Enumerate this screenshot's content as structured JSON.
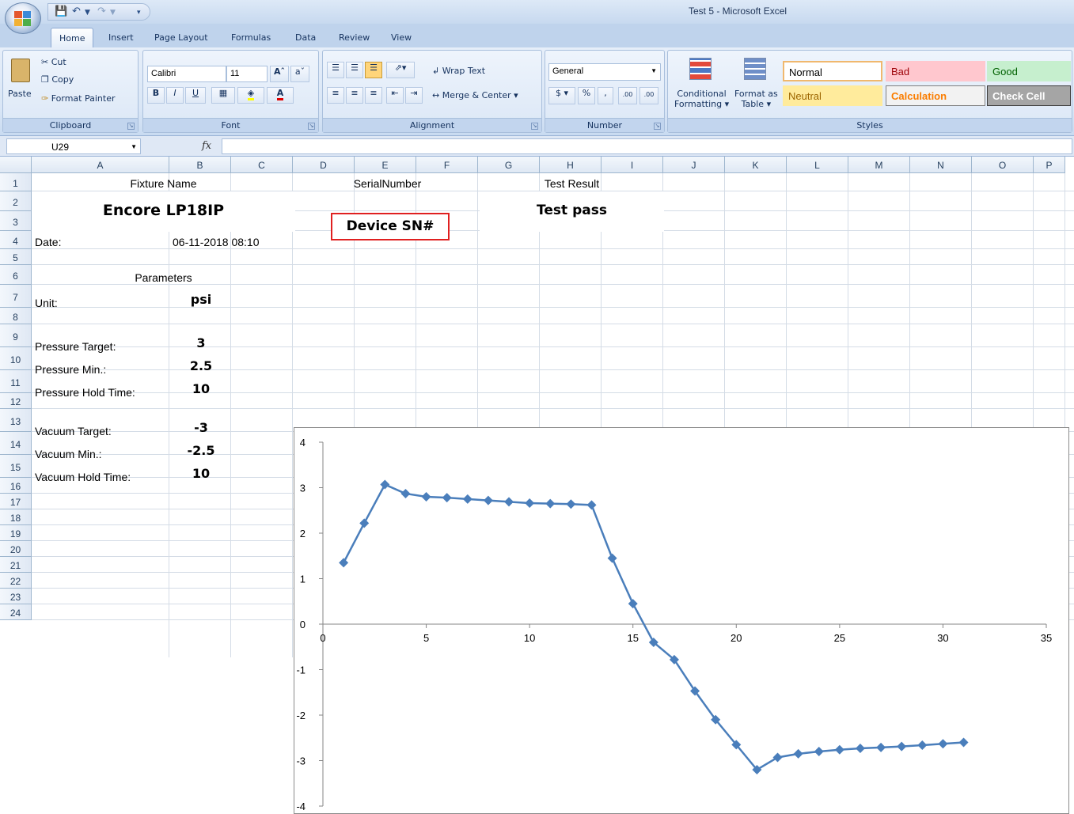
{
  "window": {
    "title": "Test 5 - Microsoft Excel"
  },
  "ribbon": {
    "tabs": [
      "Home",
      "Insert",
      "Page Layout",
      "Formulas",
      "Data",
      "Review",
      "View"
    ],
    "active_tab": "Home",
    "clipboard": {
      "paste": "Paste",
      "cut": "Cut",
      "copy": "Copy",
      "format_painter": "Format Painter",
      "label": "Clipboard"
    },
    "font": {
      "name": "Calibri",
      "size": "11",
      "label": "Font",
      "bold": "B",
      "italic": "I",
      "underline": "U"
    },
    "alignment": {
      "wrap_text": "Wrap Text",
      "merge_center": "Merge & Center",
      "label": "Alignment"
    },
    "number": {
      "format": "General",
      "label": "Number",
      "currency": "$",
      "percent": "%",
      "comma": ",",
      "inc_decimal": ".00",
      "dec_decimal": ".00"
    },
    "styles": {
      "conditional_formatting": [
        "Conditional",
        "Formatting"
      ],
      "format_as_table": [
        "Format as",
        "Table"
      ],
      "label": "Styles",
      "cells": [
        {
          "name": "Normal",
          "bg": "#ffffff",
          "fg": "#000000",
          "border": "#f0b86e"
        },
        {
          "name": "Bad",
          "bg": "#ffc7ce",
          "fg": "#9c0006",
          "border": "#ffc7ce"
        },
        {
          "name": "Good",
          "bg": "#c6efce",
          "fg": "#006100",
          "border": "#c6efce"
        },
        {
          "name": "Neutral",
          "bg": "#ffeb9c",
          "fg": "#9c6500",
          "border": "#ffeb9c"
        },
        {
          "name": "Calculation",
          "bg": "#f2f2f2",
          "fg": "#fa7d00",
          "border": "#7f7f7f"
        },
        {
          "name": "Check Cell",
          "bg": "#a5a5a5",
          "fg": "#ffffff",
          "border": "#3f3f3f"
        }
      ]
    }
  },
  "formula_bar": {
    "name_box": "U29",
    "fx": "fx",
    "value": ""
  },
  "sheet": {
    "columns": [
      "A",
      "B",
      "C",
      "D",
      "E",
      "F",
      "G",
      "H",
      "I",
      "J",
      "K",
      "L",
      "M",
      "N",
      "O",
      "P"
    ],
    "rows": [
      "1",
      "2",
      "3",
      "4",
      "5",
      "6",
      "7",
      "8",
      "9",
      "10",
      "11",
      "12",
      "13",
      "14",
      "15",
      "16",
      "17",
      "18",
      "19",
      "20",
      "21",
      "22",
      "23",
      "24"
    ],
    "header": {
      "fixture_label": "Fixture Name",
      "serial_label": "SerialNumber",
      "result_label": "Test Result"
    },
    "fixture_name": "Encore LP18IP",
    "serial_number": "Device SN#",
    "test_result": "Test pass",
    "date_label": "Date:",
    "date_value": "06-11-2018 08:10",
    "parameters_title": "Parameters",
    "parameters": [
      {
        "label": "Unit:",
        "value": "psi"
      },
      {
        "label": "Pressure Target:",
        "value": "3"
      },
      {
        "label": "Pressure Min.:",
        "value": "2.5"
      },
      {
        "label": "Pressure Hold Time:",
        "value": "10"
      },
      {
        "label": "Vacuum Target:",
        "value": "-3"
      },
      {
        "label": "Vacuum Min.:",
        "value": "-2.5"
      },
      {
        "label": "Vacuum Hold Time:",
        "value": "10"
      }
    ]
  },
  "chart_data": {
    "type": "line",
    "title": "",
    "xlabel": "",
    "ylabel": "",
    "xlim": [
      0,
      35
    ],
    "ylim": [
      -4,
      4
    ],
    "xticks": [
      0,
      5,
      10,
      15,
      20,
      25,
      30,
      35
    ],
    "yticks": [
      4,
      3,
      2,
      1,
      0,
      -1,
      -2,
      -3,
      -4
    ],
    "color": "#4a7ebb",
    "marker": "diamond",
    "grid": false,
    "x": [
      1,
      2,
      3,
      4,
      5,
      6,
      7,
      8,
      9,
      10,
      11,
      12,
      13,
      14,
      15,
      16,
      17,
      18,
      19,
      20,
      21,
      22,
      23,
      24,
      25,
      26,
      27,
      28,
      29,
      30,
      31
    ],
    "y": [
      1.35,
      2.22,
      3.07,
      2.87,
      2.8,
      2.78,
      2.75,
      2.72,
      2.69,
      2.66,
      2.65,
      2.64,
      2.62,
      1.45,
      0.45,
      -0.4,
      -0.78,
      -1.47,
      -2.1,
      -2.65,
      -3.2,
      -2.93,
      -2.85,
      -2.8,
      -2.76,
      -2.73,
      -2.71,
      -2.69,
      -2.66,
      -2.63,
      -2.6
    ]
  }
}
